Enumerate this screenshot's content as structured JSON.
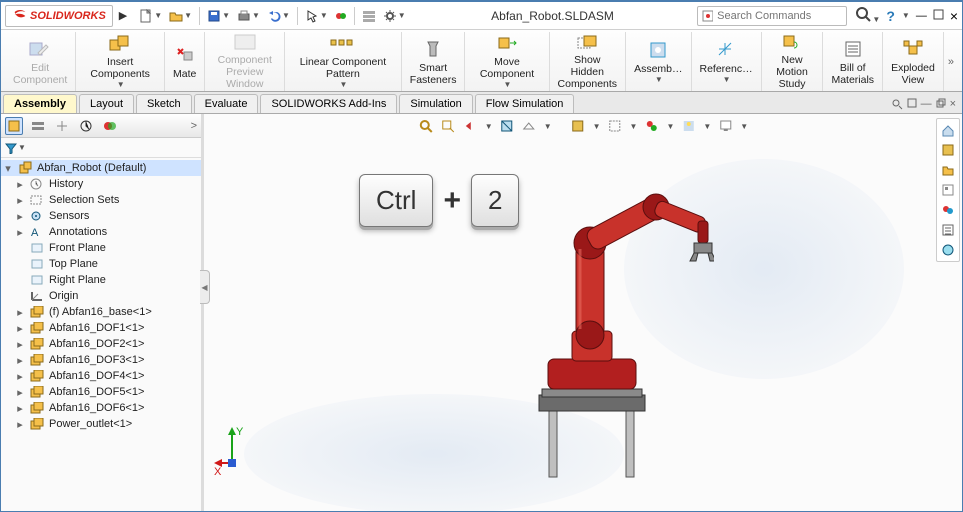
{
  "logo_text": "SOLIDWORKS",
  "document_title": "Abfan_Robot.SLDASM",
  "search_placeholder": "Search Commands",
  "ribbon": {
    "edit_component": "Edit\nComponent",
    "insert_components": "Insert Components",
    "mate": "Mate",
    "component_preview": "Component\nPreview Window",
    "linear_pattern": "Linear Component Pattern",
    "smart_fasteners": "Smart\nFasteners",
    "move_component": "Move Component",
    "show_hidden": "Show Hidden\nComponents",
    "assembly_feat": "Assemb…",
    "reference_geom": "Referenc…",
    "motion_study": "New Motion\nStudy",
    "bom": "Bill of\nMaterials",
    "exploded": "Exploded\nView"
  },
  "tabs": [
    "Assembly",
    "Layout",
    "Sketch",
    "Evaluate",
    "SOLIDWORKS Add-Ins",
    "Simulation",
    "Flow Simulation"
  ],
  "active_tab_index": 0,
  "tree_root": "Abfan_Robot  (Default)",
  "tree": [
    {
      "label": "History",
      "icon": "history"
    },
    {
      "label": "Selection Sets",
      "icon": "selset"
    },
    {
      "label": "Sensors",
      "icon": "sensors"
    },
    {
      "label": "Annotations",
      "icon": "annot"
    },
    {
      "label": "Front Plane",
      "icon": "plane"
    },
    {
      "label": "Top Plane",
      "icon": "plane"
    },
    {
      "label": "Right Plane",
      "icon": "plane"
    },
    {
      "label": "Origin",
      "icon": "origin"
    },
    {
      "label": "(f) Abfan16_base<1>",
      "icon": "part"
    },
    {
      "label": "Abfan16_DOF1<1>",
      "icon": "part"
    },
    {
      "label": "Abfan16_DOF2<1>",
      "icon": "part"
    },
    {
      "label": "Abfan16_DOF3<1>",
      "icon": "part"
    },
    {
      "label": "Abfan16_DOF4<1>",
      "icon": "part"
    },
    {
      "label": "Abfan16_DOF5<1>",
      "icon": "part"
    },
    {
      "label": "Abfan16_DOF6<1>",
      "icon": "part"
    },
    {
      "label": "Power_outlet<1>",
      "icon": "part"
    }
  ],
  "keys": {
    "ctrl": "Ctrl",
    "plus": "+",
    "two": "2"
  },
  "triad_labels": {
    "x": "X",
    "y": "Y"
  }
}
